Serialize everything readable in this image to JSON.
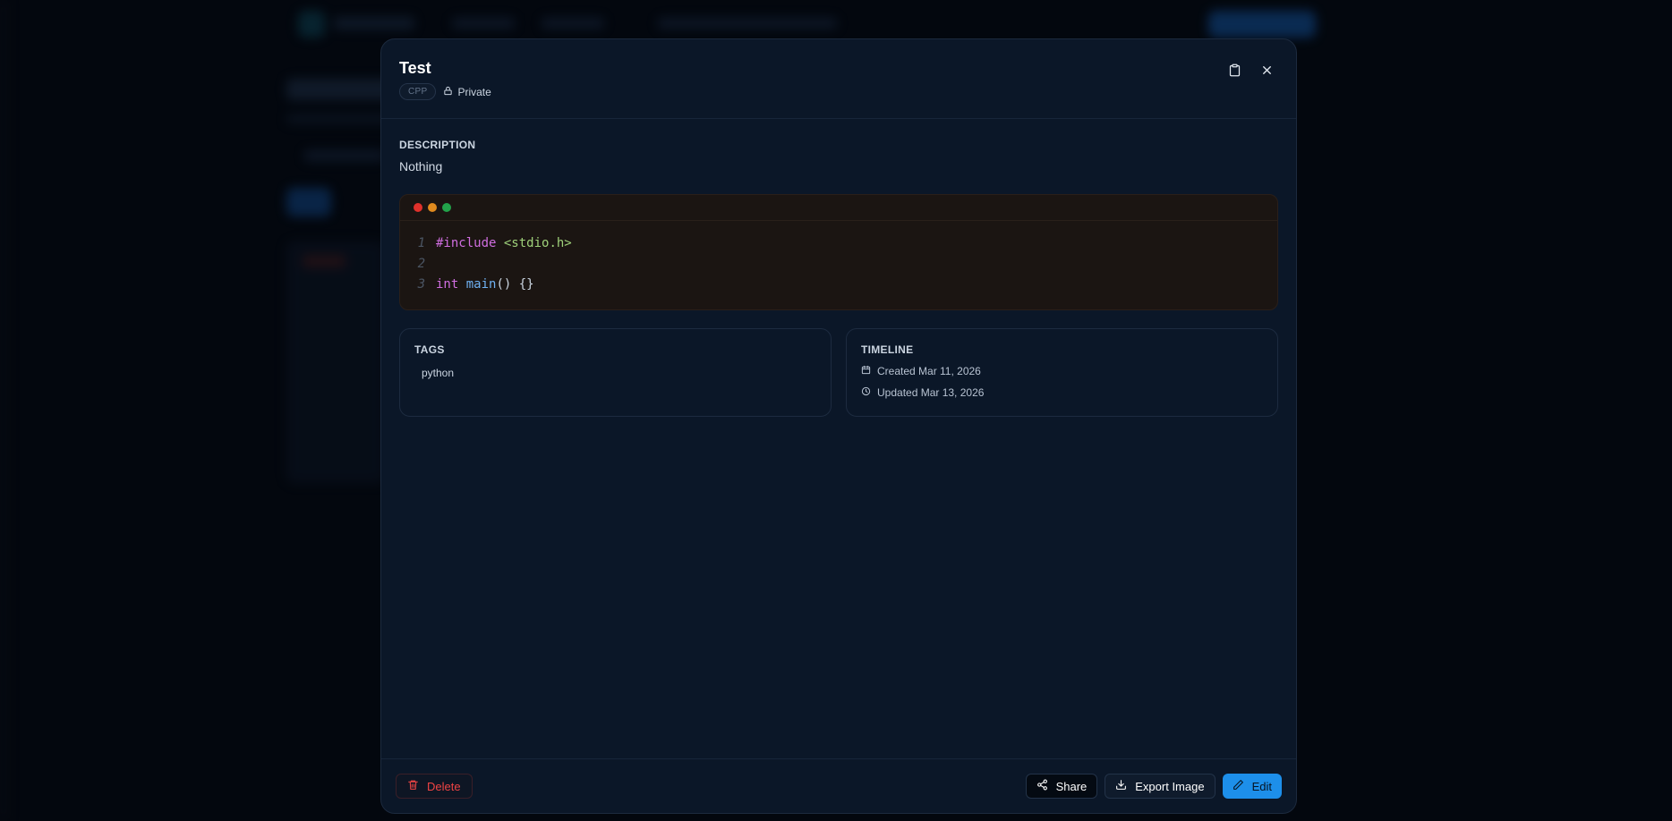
{
  "modal": {
    "title": "Test",
    "language_badge": "CPP",
    "visibility_label": "Private",
    "header_actions": [
      {
        "icon": "clipboard-icon"
      },
      {
        "icon": "close-icon"
      }
    ]
  },
  "description": {
    "label": "DESCRIPTION",
    "text": "Nothing"
  },
  "code": {
    "window_dots": [
      "#e0312b",
      "#e08a1e",
      "#22a34a"
    ],
    "lines": [
      {
        "number": "1",
        "tokens": [
          {
            "text": "#include",
            "color": "#d06ee0"
          },
          {
            "text": " ",
            "color": "#cbd5e1"
          },
          {
            "text": "<stdio.h>",
            "color": "#9fd17a"
          }
        ]
      },
      {
        "number": "2",
        "tokens": []
      },
      {
        "number": "3",
        "tokens": [
          {
            "text": "int",
            "color": "#d06ee0"
          },
          {
            "text": " ",
            "color": "#cbd5e1"
          },
          {
            "text": "main",
            "color": "#6fb1f2"
          },
          {
            "text": "() {}",
            "color": "#cbd5e1"
          }
        ]
      }
    ]
  },
  "tags": {
    "label": "TAGS",
    "items": [
      "python"
    ]
  },
  "timeline": {
    "label": "TIMELINE",
    "created": "Created Mar 11, 2026",
    "updated": "Updated Mar 13, 2026"
  },
  "footer": {
    "delete_label": "Delete",
    "share_label": "Share",
    "export_label": "Export Image",
    "edit_label": "Edit"
  },
  "colors": {
    "accent": "#1d8fea",
    "danger": "#ef4444",
    "modal_bg": "#0b1728"
  }
}
